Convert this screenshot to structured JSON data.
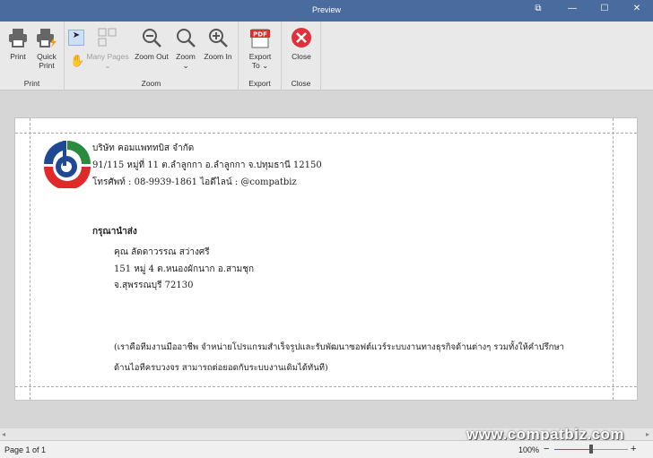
{
  "window": {
    "title": "Preview",
    "restore_icon": "⧉",
    "minimize": "—",
    "maximize": "☐",
    "close": "✕"
  },
  "ribbon": {
    "groups": {
      "print": "Print",
      "zoom": "Zoom",
      "export": "Export",
      "close": "Close"
    },
    "print": "Print",
    "quick_print_1": "Quick",
    "quick_print_2": "Print",
    "many_pages": "Many Pages",
    "zoom_out": "Zoom Out",
    "zoom": "Zoom",
    "zoom_in": "Zoom In",
    "export_1": "Export",
    "export_2": "To",
    "pdf": "PDF",
    "close": "Close",
    "chevron": "⌄"
  },
  "document": {
    "company": "บริษัท คอมแพททบิส จำกัด",
    "address": "91/115 หมู่ที่ 11 ต.ลำลูกกา อ.ลำลูกกา จ.ปทุมธานี 12150",
    "phone": "โทรศัพท์ : 08-9939-1861 ไอดีไลน์ : @compatbiz",
    "deliver_to": "กรุณานำส่ง",
    "recipient": "คุณ ลัดดาวรรณ สว่างศรี",
    "recipient_address": "151 หมู่ 4 ต.หนองผักนาก อ.สามชุก",
    "recipient_province": "จ.สุพรรณบุรี 72130",
    "note_1": "(เราคือทีมงานมืออาชีพ จำหน่ายโปรแกรมสำเร็จรูปและรับพัฒนาซอฟต์แวร์ระบบงานทางธุรกิจด้านต่างๆ รวมทั้งให้คำปรึกษา",
    "note_2": "ด้านไอทีครบวงจร สามารถต่อยอดกับระบบงานเดิมได้ทันที)"
  },
  "status": {
    "page": "Page 1 of 1",
    "zoom": "100%",
    "zoom_level": 100,
    "minus": "−",
    "plus": "+"
  },
  "watermark": "www.compatbiz.com"
}
